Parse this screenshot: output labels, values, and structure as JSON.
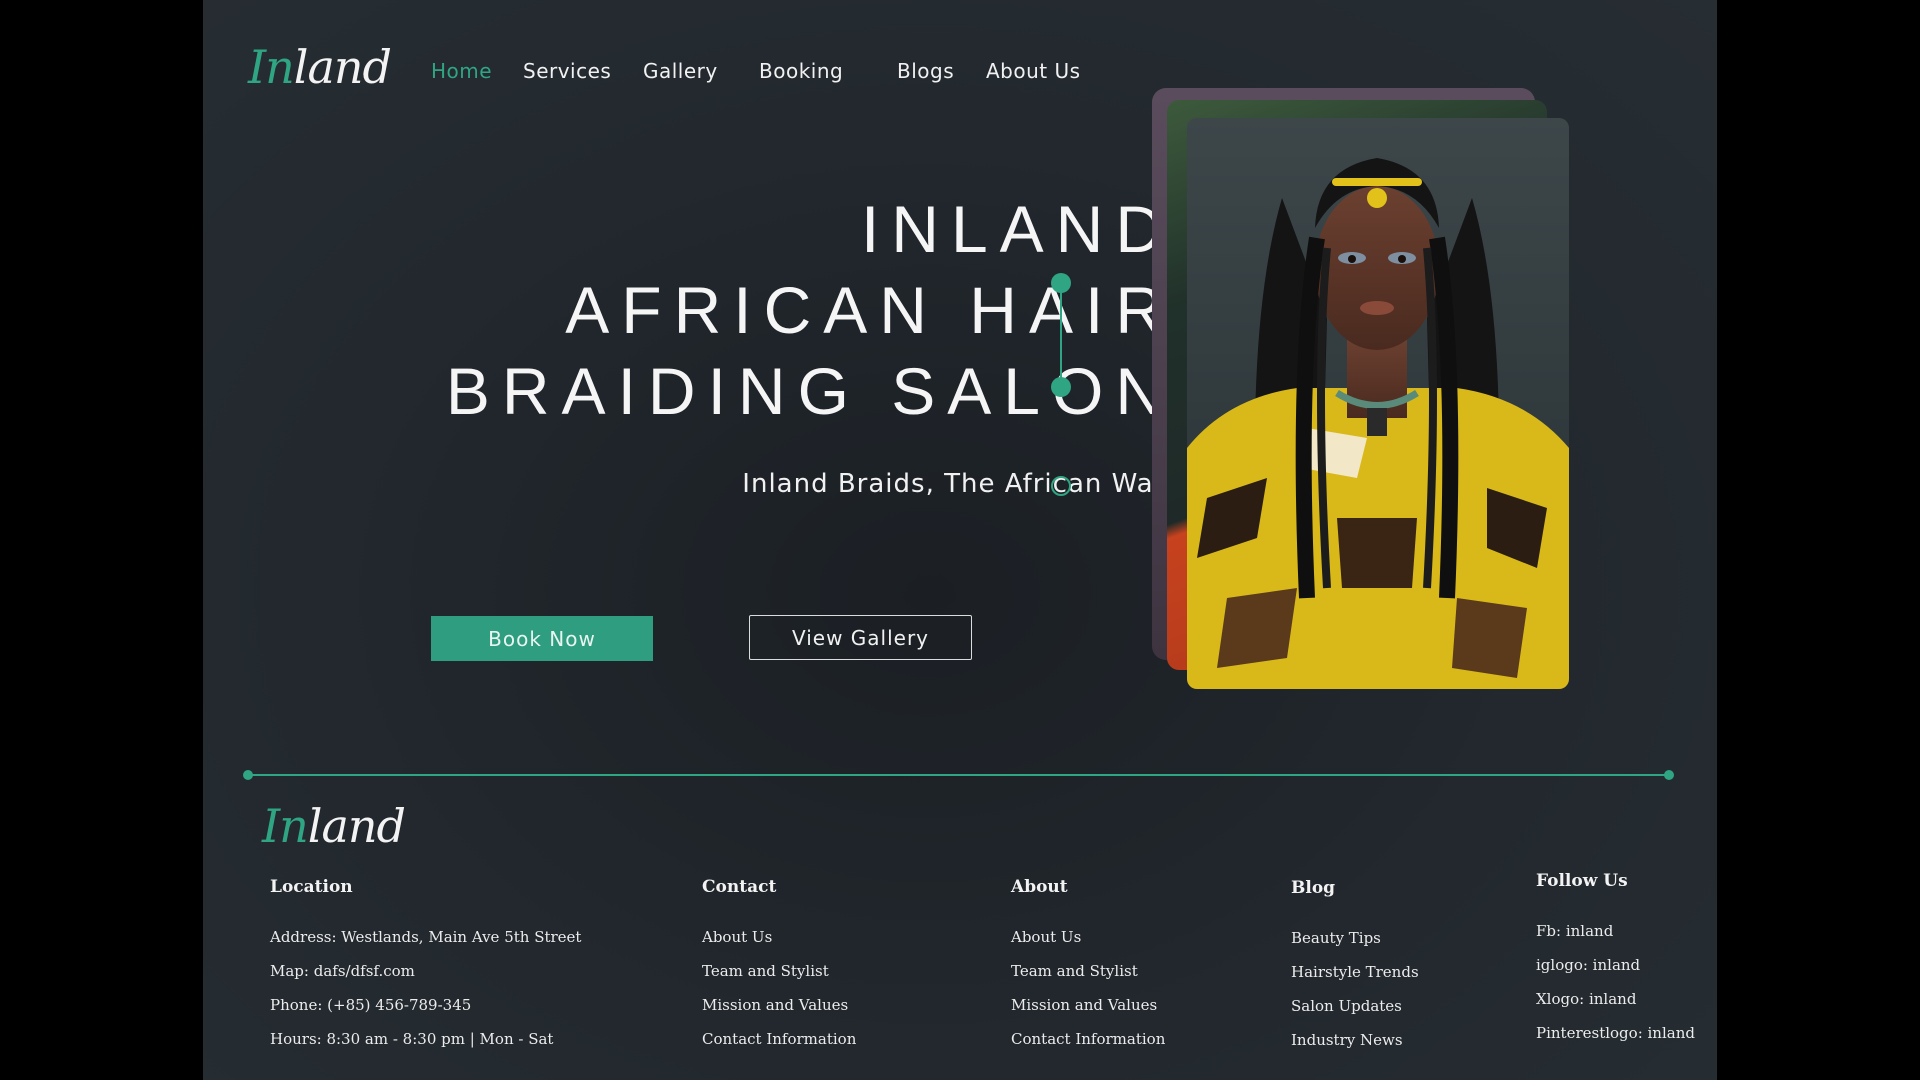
{
  "brand": {
    "logo_first": "In",
    "logo_rest": "land"
  },
  "nav": {
    "items": [
      {
        "label": "Home",
        "active": true
      },
      {
        "label": "Services"
      },
      {
        "label": "Gallery"
      },
      {
        "label": "Booking"
      },
      {
        "label": "Blogs"
      },
      {
        "label": "About Us"
      }
    ]
  },
  "hero": {
    "title_lines": [
      "INLAND",
      "AFRICAN HAIR",
      "BRAIDING SALON"
    ],
    "tagline": "Inland Braids, The African Way",
    "book_button": "Book Now",
    "gallery_button": "View Gallery"
  },
  "footer": {
    "location": {
      "heading": "Location",
      "lines": [
        "Address: Westlands, Main Ave 5th Street",
        "Map: dafs/dfsf.com",
        "Phone: (+85) 456-789-345",
        "Hours: 8:30 am - 8:30 pm | Mon - Sat"
      ]
    },
    "contact": {
      "heading": "Contact",
      "links": [
        "About Us",
        "Team and Stylist",
        "Mission and Values",
        "Contact Information"
      ]
    },
    "about": {
      "heading": "About",
      "links": [
        "About Us",
        "Team and Stylist",
        "Mission and Values",
        "Contact Information"
      ]
    },
    "blog": {
      "heading": "Blog",
      "links": [
        "Beauty Tips",
        "Hairstyle Trends",
        "Salon Updates",
        "Industry News"
      ]
    },
    "follow": {
      "heading": "Follow Us",
      "links": [
        "Fb: inland",
        "iglogo: inland",
        "Xlogo: inland",
        "Pinterestlogo: inland"
      ]
    }
  },
  "colors": {
    "accent": "#2fa583",
    "background": "#22282e",
    "button": "#2e9d80"
  }
}
